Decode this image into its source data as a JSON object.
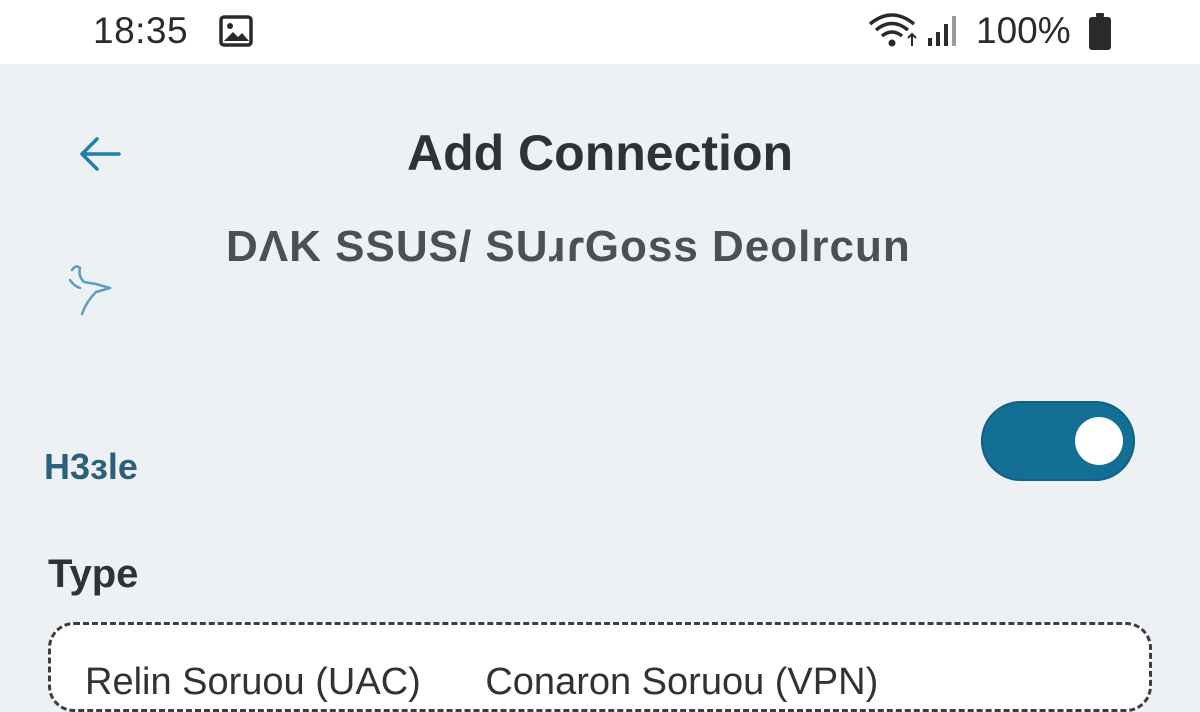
{
  "status_bar": {
    "time": "18:35",
    "battery": "100%",
    "icons": [
      "image-icon",
      "wifi-icon",
      "signal-icon",
      "battery-icon"
    ]
  },
  "header": {
    "title": "Add Connection",
    "subtitle": "DΛK SSUS/ SUɹɾGoss Deolrcun",
    "back_icon": "arrow-left-icon"
  },
  "form": {
    "enable_label": "H3ɜle",
    "enable_toggle_on": true,
    "type_label": "Type",
    "type_options": [
      "Relin Soruou (UAC)",
      "Conaron Soruou (VPN)"
    ]
  },
  "colors": {
    "accent": "#146f95",
    "background": "#eef1f4",
    "label_blue": "#2c5f7a"
  }
}
